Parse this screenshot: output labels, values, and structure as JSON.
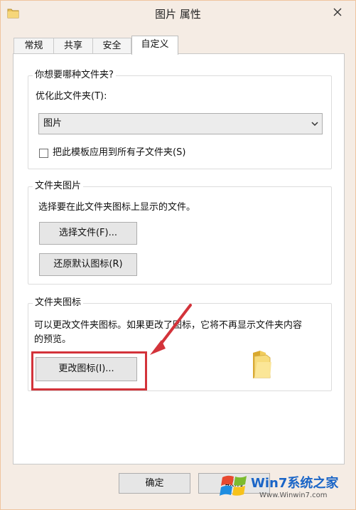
{
  "window": {
    "title": "图片 属性",
    "title_icon": "folder-icon",
    "close_icon": "close-icon"
  },
  "tabs": [
    {
      "label": "常规",
      "active": false
    },
    {
      "label": "共享",
      "active": false
    },
    {
      "label": "安全",
      "active": false
    },
    {
      "label": "自定义",
      "active": true
    }
  ],
  "folder_type": {
    "legend": "你想要哪种文件夹?",
    "optimize_label": "优化此文件夹(T):",
    "selected_option": "图片",
    "apply_subfolders_label": "把此模板应用到所有子文件夹(S)",
    "apply_subfolders_checked": false
  },
  "folder_pictures": {
    "legend": "文件夹图片",
    "description": "选择要在此文件夹图标上显示的文件。",
    "choose_file_button": "选择文件(F)...",
    "restore_default_button": "还原默认图标(R)"
  },
  "folder_icons": {
    "legend": "文件夹图标",
    "description_line1": "可以更改文件夹图标。如果更改了图标，它将不再显示文件夹内容",
    "description_line2": "的预览。",
    "change_icon_button": "更改图标(I)...",
    "annotation_color": "#d3333a"
  },
  "footer": {
    "ok_button": "确定",
    "cancel_button": "取消"
  },
  "watermark": {
    "brand": "Win7系统之家",
    "url": "Www.Winwin7.com"
  },
  "colors": {
    "window_bg": "#f5ece4",
    "window_border": "#f0c49e",
    "button_bg": "#e6e6e6",
    "accent_red": "#d3333a"
  }
}
